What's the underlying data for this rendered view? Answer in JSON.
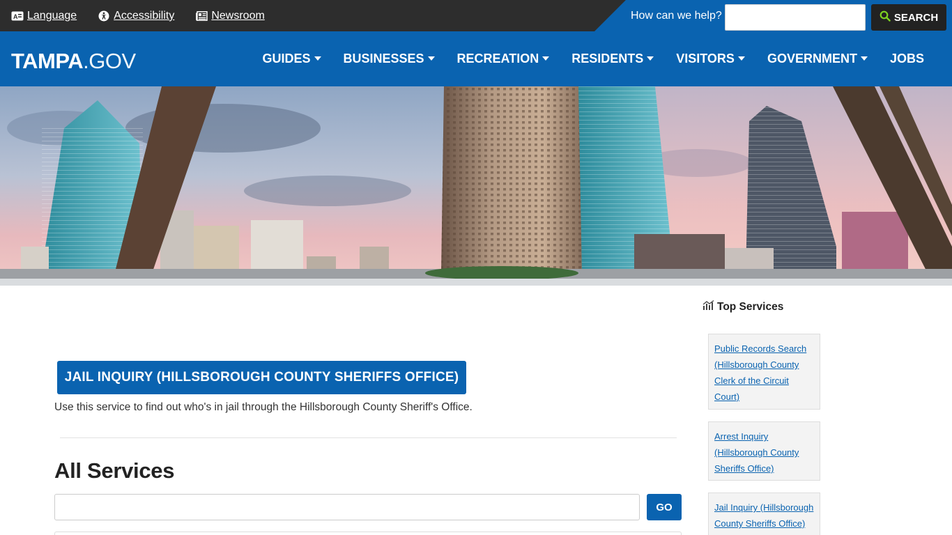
{
  "utility": {
    "links": [
      {
        "label": "Language",
        "icon": "language-icon"
      },
      {
        "label": "Accessibility",
        "icon": "accessibility-icon"
      },
      {
        "label": "Newsroom",
        "icon": "newspaper-icon"
      }
    ],
    "help_label": "How can we help?",
    "search_value": "",
    "search_button": "SEARCH"
  },
  "nav": {
    "logo_strong": "TAMPA",
    "logo_light": ".GOV",
    "items": [
      {
        "label": "GUIDES",
        "dropdown": true
      },
      {
        "label": "BUSINESSES",
        "dropdown": true
      },
      {
        "label": "RECREATION",
        "dropdown": true
      },
      {
        "label": "RESIDENTS",
        "dropdown": true
      },
      {
        "label": "VISITORS",
        "dropdown": true
      },
      {
        "label": "GOVERNMENT",
        "dropdown": true
      },
      {
        "label": "JOBS",
        "dropdown": false
      }
    ]
  },
  "main": {
    "service_button": "JAIL INQUIRY (HILLSBOROUGH COUNTY SHERIFFS OFFICE)",
    "service_description": "Use this service to find out who's in jail through the Hillsborough County Sheriff's Office.",
    "all_services_title": "All Services",
    "all_services_value": "",
    "go_button": "GO"
  },
  "sidebar": {
    "title": "Top Services",
    "services": [
      "Public Records Search (Hillsborough County Clerk of the Circuit Court)",
      "Arrest Inquiry (Hillsborough County Sheriffs Office)",
      "Jail Inquiry (Hillsborough County Sheriffs Office)"
    ]
  },
  "colors": {
    "brand_blue": "#0a63b0",
    "utility_bg": "#2d2d2d",
    "search_icon": "#7ed321"
  }
}
